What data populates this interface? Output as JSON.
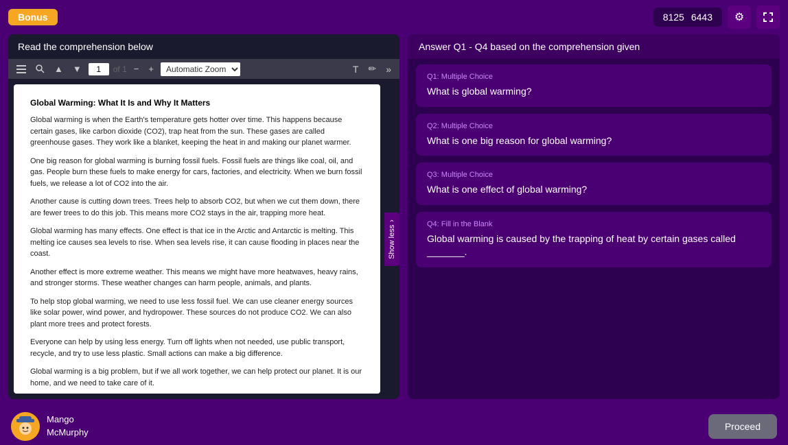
{
  "topbar": {
    "bonus_label": "Bonus",
    "score1": "8125",
    "score2": "6443",
    "gear_icon": "⚙",
    "expand_icon": "⛶"
  },
  "left_panel": {
    "header": "Read the comprehension below",
    "toolbar": {
      "page_input": "1",
      "page_of": "of 1",
      "zoom_option": "Automatic Zoom"
    },
    "show_less_label": "Show less",
    "content": {
      "title": "Global Warming: What It Is and Why It Matters",
      "paragraphs": [
        "Global warming is when the Earth's temperature gets hotter over time. This happens because certain gases, like carbon dioxide (CO2), trap heat from the sun. These gases are called greenhouse gases. They work like a blanket, keeping the heat in and making our planet warmer.",
        "One big reason for global warming is burning fossil fuels. Fossil fuels are things like coal, oil, and gas. People burn these fuels to make energy for cars, factories, and electricity. When we burn fossil fuels, we release a lot of CO2 into the air.",
        "Another cause is cutting down trees. Trees help to absorb CO2, but when we cut them down, there are fewer trees to do this job. This means more CO2 stays in the air, trapping more heat.",
        "Global warming has many effects. One effect is that ice in the Arctic and Antarctic is melting. This melting ice causes sea levels to rise. When sea levels rise, it can cause flooding in places near the coast.",
        "Another effect is more extreme weather. This means we might have more heatwaves, heavy rains, and stronger storms. These weather changes can harm people, animals, and plants.",
        "To help stop global warming, we need to use less fossil fuel. We can use cleaner energy sources like solar power, wind power, and hydropower. These sources do not produce CO2. We can also plant more trees and protect forests.",
        "Everyone can help by using less energy. Turn off lights when not needed, use public transport, recycle, and try to use less plastic. Small actions can make a big difference.",
        "Global warming is a big problem, but if we all work together, we can help protect our planet. It is our home, and we need to take care of it."
      ]
    }
  },
  "right_panel": {
    "header": "Answer Q1 - Q4 based on the comprehension given",
    "questions": [
      {
        "type": "Q1: Multiple Choice",
        "text": "What is global warming?"
      },
      {
        "type": "Q2: Multiple Choice",
        "text": "What is one big reason for global warming?"
      },
      {
        "type": "Q3: Multiple Choice",
        "text": "What is one effect of global warming?"
      },
      {
        "type": "Q4: Fill in the Blank",
        "text": "Global warming is caused by the trapping of heat by certain gases called _______."
      }
    ]
  },
  "bottom": {
    "avatar_emoji": "🧢",
    "user_line1": "Mango",
    "user_line2": "McMurphy",
    "proceed_label": "Proceed"
  }
}
